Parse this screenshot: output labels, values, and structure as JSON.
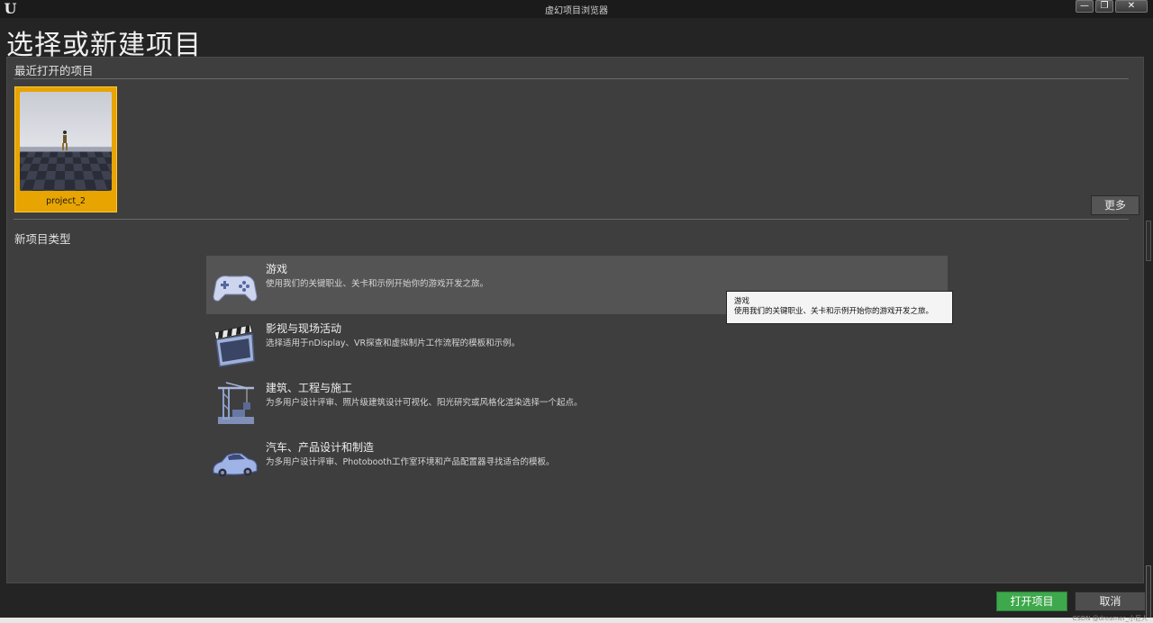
{
  "window": {
    "title": "虚幻项目浏览器",
    "min_symbol": "—",
    "max_symbol": "❐",
    "close_symbol": "✕"
  },
  "page": {
    "title": "选择或新建项目"
  },
  "recent": {
    "header": "最近打开的项目",
    "projects": [
      {
        "name": "project_2",
        "selected": true
      }
    ],
    "more_button": "更多"
  },
  "new_project": {
    "header": "新项目类型",
    "templates": [
      {
        "title": "游戏",
        "description": "使用我们的关键职业、关卡和示例开始你的游戏开发之旅。",
        "icon": "gamepad-icon",
        "hovered": true
      },
      {
        "title": "影视与现场活动",
        "description": "选择适用于nDisplay、VR探查和虚拟制片工作流程的模板和示例。",
        "icon": "clapperboard-icon",
        "hovered": false
      },
      {
        "title": "建筑、工程与施工",
        "description": "为多用户设计评审、照片级建筑设计可视化、阳光研究或风格化渲染选择一个起点。",
        "icon": "crane-icon",
        "hovered": false
      },
      {
        "title": "汽车、产品设计和制造",
        "description": "为多用户设计评审、Photobooth工作室环境和产品配置器寻找适合的模板。",
        "icon": "car-icon",
        "hovered": false
      }
    ]
  },
  "tooltip": {
    "title": "游戏",
    "text": "使用我们的关键职业、关卡和示例开始你的游戏开发之旅。"
  },
  "footer": {
    "open_button": "打开项目",
    "cancel_button": "取消",
    "watermark": "CSDN @dreamer_小巨人"
  },
  "colors": {
    "accent_selected": "#e8a400",
    "open_button": "#3ea84c",
    "panel": "#3e3e3e",
    "background": "#242424"
  }
}
